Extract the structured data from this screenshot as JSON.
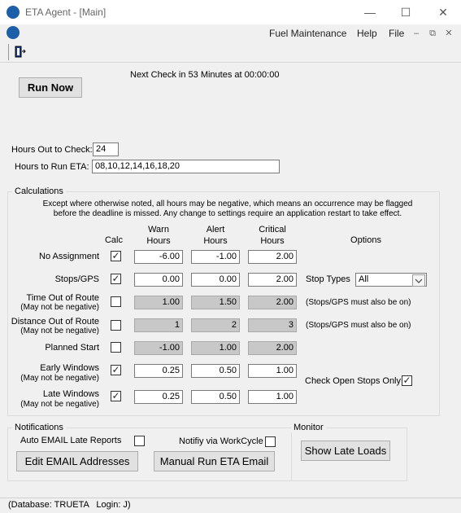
{
  "window": {
    "title": "ETA Agent - [Main]",
    "minimize": "—",
    "maximize": "☐",
    "close": "✕"
  },
  "menubar": {
    "items": [
      "Fuel Maintenance",
      "Help",
      "File"
    ],
    "mdi_min": "–",
    "mdi_restore": "⧉",
    "mdi_close": "✕"
  },
  "main": {
    "run_now": "Run Now",
    "next_check": "Next Check in 53 Minutes at 00:00:00",
    "hours_out_label": "Hours Out to Check:",
    "hours_out_value": "24",
    "hours_run_label": "Hours to Run ETA:",
    "hours_run_value": "08,10,12,14,16,18,20"
  },
  "calc": {
    "group_label": "Calculations",
    "note_line1": "Except where otherwise noted, all hours may be negative, which means an occurrence may be flagged",
    "note_line2": "before the deadline is missed. Any change to settings require an application restart to take effect.",
    "hdr_calc": "Calc",
    "hdr_warn_1": "Warn",
    "hdr_warn_2": "Hours",
    "hdr_alert_1": "Alert",
    "hdr_alert_2": "Hours",
    "hdr_crit_1": "Critical",
    "hdr_crit_2": "Hours",
    "hdr_options": "Options",
    "rows": [
      {
        "label": "No Assignment",
        "sub": "",
        "checked": "✓",
        "warn": "-6.00",
        "alert": "-1.00",
        "crit": "2.00"
      },
      {
        "label": "Stops/GPS",
        "sub": "",
        "checked": "✓",
        "warn": "0.00",
        "alert": "0.00",
        "crit": "2.00"
      },
      {
        "label": "Time Out of Route",
        "sub": "(May not be negative)",
        "checked": "",
        "warn": "1.00",
        "alert": "1.50",
        "crit": "2.00"
      },
      {
        "label": "Distance Out of Route",
        "sub": "(May not be negative)",
        "checked": "",
        "warn": "1",
        "alert": "2",
        "crit": "3"
      },
      {
        "label": "Planned Start",
        "sub": "",
        "checked": "",
        "warn": "-1.00",
        "alert": "1.00",
        "crit": "2.00"
      },
      {
        "label": "Early Windows",
        "sub": "(May not be negative)",
        "checked": "✓",
        "warn": "0.25",
        "alert": "0.50",
        "crit": "1.00"
      },
      {
        "label": "Late Windows",
        "sub": "(May not be negative)",
        "checked": "✓",
        "warn": "0.25",
        "alert": "0.50",
        "crit": "1.00"
      }
    ],
    "stop_types_label": "Stop Types",
    "stop_types_value": "All",
    "gps_note": "(Stops/GPS must also be on)",
    "check_open_stops": "Check Open Stops Only",
    "check_open_stops_checked": "✓"
  },
  "notifications": {
    "group_label": "Notifications",
    "auto_email": "Auto EMAIL Late Reports",
    "notify_workcycle": "Notifiy via WorkCycle",
    "edit_email": "Edit EMAIL Addresses",
    "manual_run": "Manual Run ETA Email"
  },
  "monitor": {
    "group_label": "Monitor",
    "show_late": "Show Late Loads"
  },
  "status": {
    "text": "(Database: TRUETA   Login: J)"
  }
}
